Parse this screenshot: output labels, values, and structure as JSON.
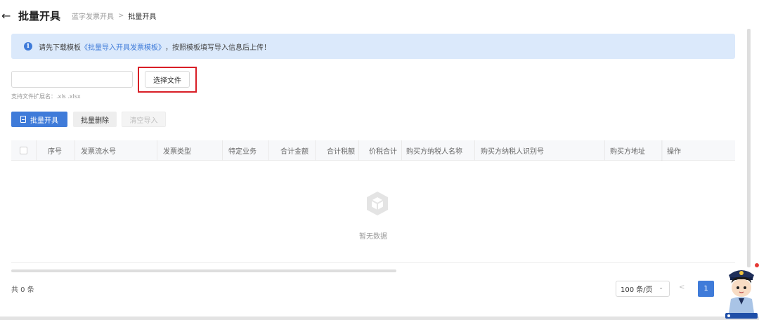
{
  "header": {
    "back_icon": "arrow-left-icon",
    "title": "批量开具",
    "crumb_parent": "蓝字发票开具",
    "crumb_sep": ">",
    "crumb_current": "批量开具"
  },
  "alert": {
    "icon": "info-icon",
    "prefix": "请先下载模板",
    "link": "《批量导入开具发票模板》",
    "suffix": "，按照模板填写导入信息后上传！"
  },
  "upload": {
    "file_value": "",
    "choose_label": "选择文件",
    "hint": "支持文件扩展名：.xls .xlsx"
  },
  "actions": {
    "batch_issue": "批量开具",
    "batch_delete": "批量删除",
    "clear_import": "清空导入"
  },
  "table": {
    "columns": [
      "序号",
      "发票流水号",
      "发票类型",
      "特定业务",
      "合计金额",
      "合计税额",
      "价税合计",
      "购买方纳税人名称",
      "购买方纳税人识别号",
      "购买方地址",
      "操作"
    ],
    "empty_text": "暂无数据",
    "rows": []
  },
  "pagination": {
    "total": "共 0 条",
    "page_size": "100 条/页",
    "prev": "<",
    "current_page": "1"
  },
  "colors": {
    "primary": "#3f7bd9",
    "alert_bg": "#dbe9fb",
    "highlight": "#d81e26"
  }
}
